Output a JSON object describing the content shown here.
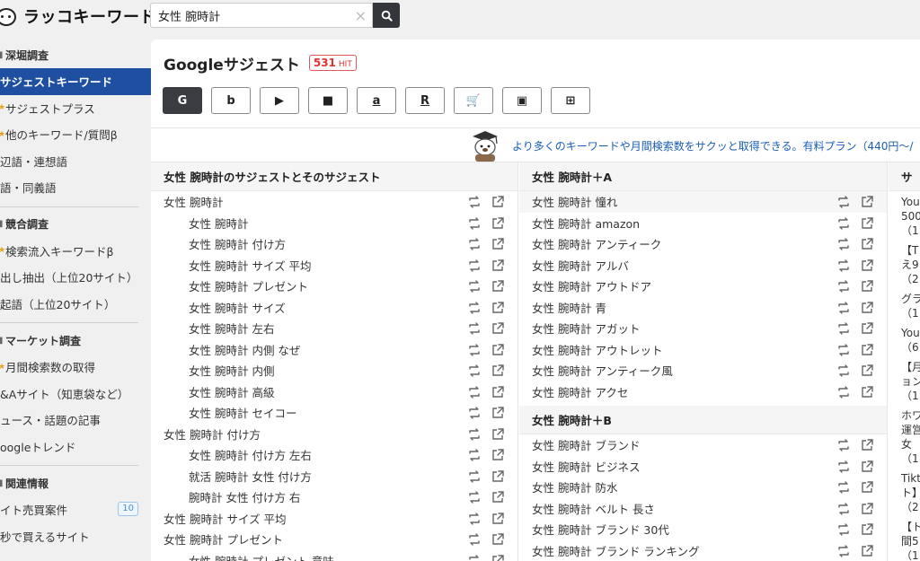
{
  "app": {
    "logo_text": "ラッコキーワード"
  },
  "search": {
    "value": "女性 腕時計",
    "clear_label": "×"
  },
  "sidebar": {
    "sections": [
      {
        "heading": "深堀調査",
        "items": [
          {
            "label": "サジェストキーワード",
            "active": true
          },
          {
            "label": "サジェストプラス",
            "star": true
          },
          {
            "label": "他のキーワード/質問β",
            "star": true
          },
          {
            "label": "辺語・連想語"
          },
          {
            "label": "語・同義語"
          }
        ]
      },
      {
        "heading": "競合調査",
        "items": [
          {
            "label": "検索流入キーワードβ",
            "star": true
          },
          {
            "label": "出し抽出（上位20サイト）"
          },
          {
            "label": "起語（上位20サイト）"
          }
        ]
      },
      {
        "heading": "マーケット調査",
        "items": [
          {
            "label": "月間検索数の取得",
            "star": true
          },
          {
            "label": "&Aサイト（知恵袋など）"
          },
          {
            "label": "ュース・話題の記事"
          },
          {
            "label": "oogleトレンド"
          }
        ]
      },
      {
        "heading": "関連情報",
        "items": [
          {
            "label": "イト売買案件",
            "badge": "10"
          },
          {
            "label": "秒で買えるサイト"
          }
        ]
      }
    ]
  },
  "main": {
    "title": "Googleサジェスト",
    "hit_count": "531",
    "hit_unit": "HIT",
    "engines": [
      {
        "name": "google",
        "glyph": "G",
        "active": true
      },
      {
        "name": "bing",
        "glyph": "b"
      },
      {
        "name": "youtube",
        "glyph": "▶"
      },
      {
        "name": "video",
        "glyph": "■"
      },
      {
        "name": "amazon",
        "glyph": "a"
      },
      {
        "name": "rakuten",
        "glyph": "R"
      },
      {
        "name": "shopping",
        "glyph": "🛒"
      },
      {
        "name": "image",
        "glyph": "▣"
      },
      {
        "name": "apps",
        "glyph": "⊞"
      }
    ],
    "promo_text": "より多くのキーワードや月間検索数をサクッと取得できる。有料プラン（440円〜/"
  },
  "columns": [
    {
      "header": "女性 腕時計のサジェストとそのサジェスト",
      "rows": [
        {
          "text": "女性 腕時計",
          "sub": false
        },
        {
          "text": "女性 腕時計",
          "sub": true
        },
        {
          "text": "女性 腕時計 付け方",
          "sub": true
        },
        {
          "text": "女性 腕時計 サイズ 平均",
          "sub": true
        },
        {
          "text": "女性 腕時計 プレゼント",
          "sub": true
        },
        {
          "text": "女性 腕時計 サイズ",
          "sub": true
        },
        {
          "text": "女性 腕時計 左右",
          "sub": true
        },
        {
          "text": "女性 腕時計 内側 なぜ",
          "sub": true
        },
        {
          "text": "女性 腕時計 内側",
          "sub": true
        },
        {
          "text": "女性 腕時計 高級",
          "sub": true
        },
        {
          "text": "女性 腕時計 セイコー",
          "sub": true
        },
        {
          "text": "女性 腕時計 付け方",
          "sub": false
        },
        {
          "text": "女性 腕時計 付け方 左右",
          "sub": true
        },
        {
          "text": "就活 腕時計 女性 付け方",
          "sub": true
        },
        {
          "text": "腕時計 女性 付け方 右",
          "sub": true
        },
        {
          "text": "女性 腕時計 サイズ 平均",
          "sub": false
        },
        {
          "text": "女性 腕時計 プレゼント",
          "sub": false
        },
        {
          "text": "女性 腕時計 プレゼント 意味",
          "sub": true
        }
      ]
    },
    {
      "groups": [
        {
          "header": "女性 腕時計＋A",
          "rows": [
            {
              "text": "女性 腕時計 憧れ",
              "hl": true
            },
            {
              "text": "女性 腕時計 amazon"
            },
            {
              "text": "女性 腕時計 アンティーク"
            },
            {
              "text": "女性 腕時計 アルバ"
            },
            {
              "text": "女性 腕時計 アウトドア"
            },
            {
              "text": "女性 腕時計 青"
            },
            {
              "text": "女性 腕時計 アガット"
            },
            {
              "text": "女性 腕時計 アウトレット"
            },
            {
              "text": "女性 腕時計 アンティーク風"
            },
            {
              "text": "女性 腕時計 アクセ"
            }
          ]
        },
        {
          "header": "女性 腕時計＋B",
          "rows": [
            {
              "text": "女性 腕時計 ブランド"
            },
            {
              "text": "女性 腕時計 ビジネス"
            },
            {
              "text": "女性 腕時計 防水"
            },
            {
              "text": "女性 腕時計 ベルト 長さ"
            },
            {
              "text": "女性 腕時計 ブランド 30代"
            },
            {
              "text": "女性 腕時計 ブランド ランキング"
            }
          ]
        }
      ]
    },
    {
      "header": "サ",
      "blocks": [
        [
          "You",
          "500",
          "（1"
        ],
        [
          "【T",
          "え9",
          "（2"
        ],
        [
          "グラ",
          "（1"
        ],
        [
          "You",
          "（6"
        ],
        [
          "【月",
          "ョン",
          "（1"
        ],
        [
          "ホワ",
          "運営",
          "女",
          "（1"
        ],
        [
          "Tikt",
          "ト】",
          "（2"
        ],
        [
          "【ト",
          "間5",
          "（1"
        ]
      ]
    }
  ]
}
